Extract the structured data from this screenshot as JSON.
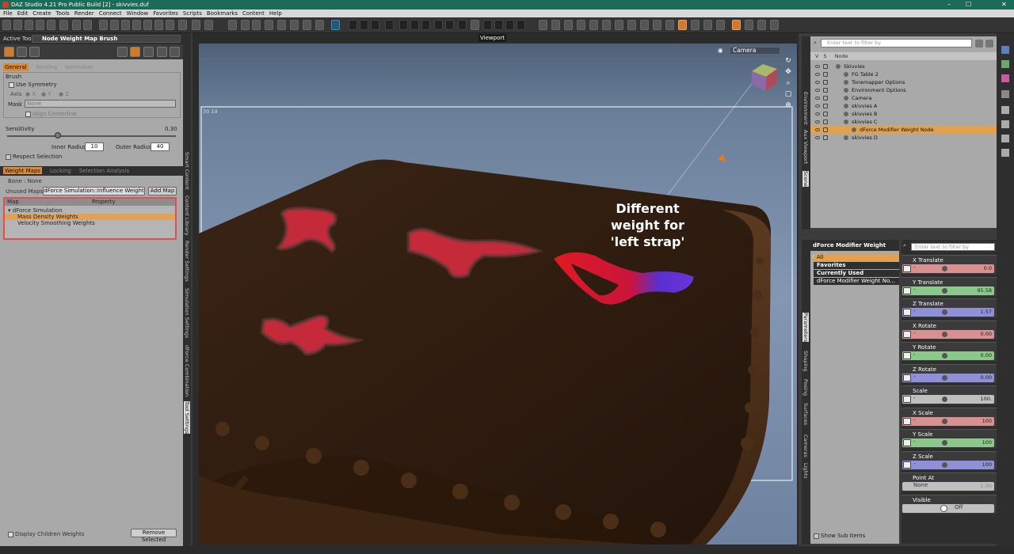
{
  "window": {
    "title": "DAZ Studio 4.21 Pro Public Build [2] - skivvies.duf",
    "minimize": "–",
    "maximize": "☐",
    "close": "✕"
  },
  "menu": [
    "File",
    "Edit",
    "Create",
    "Tools",
    "Render",
    "Connect",
    "Window",
    "Favorites",
    "Scripts",
    "Bookmarks",
    "Content",
    "Help"
  ],
  "left_panel": {
    "active_tool_label": "Active Tool",
    "active_tool_value": "Node Weight Map Brush",
    "tabs": [
      "General",
      "Binding",
      "Normalize"
    ],
    "brush_heading": "Brush",
    "use_symmetry_label": "Use Symmetry",
    "axis_label": "Axis",
    "axis_options": [
      "X",
      "Y",
      "Z"
    ],
    "mask_label": "Mask",
    "mask_value": "None",
    "align_centerline_label": "Align Centerline",
    "sensitivity_label": "Sensitivity",
    "sensitivity_value": "0.30",
    "sensitivity_level": 0.3,
    "inner_radius_label": "Inner Radius",
    "inner_radius_value": "10",
    "outer_radius_label": "Outer Radius",
    "outer_radius_value": "40",
    "respect_selection_label": "Respect Selection",
    "weight_tabs": [
      "Weight Maps",
      "Locking",
      "Selection Analysis"
    ],
    "bone_text": "Bone : None",
    "unused_maps_label": "Unused Maps",
    "unused_maps_value": "dForce Simulation::Influence Weight",
    "add_map_label": "Add Map",
    "map_col": "Map",
    "property_col": "Property",
    "map_group": "dForce Simulation",
    "map_items": [
      "Mass Density Weights",
      "Velocity Smoothing Weights"
    ],
    "display_children_label": "Display Children Weights",
    "remove_selected_label": "Remove Selected"
  },
  "left_side_tabs": [
    "Smart Content",
    "Content Library",
    "Render Settings",
    "Simulation Settings",
    "dForce Combination",
    "Tool Settings"
  ],
  "viewport": {
    "title": "Viewport",
    "camera_label": "Camera",
    "frame_label": "30   19",
    "annotation": [
      "Different",
      "weight for",
      "'left strap'"
    ]
  },
  "scene": {
    "filter_placeholder": "Enter text to filter by",
    "col_v": "V",
    "col_s": "S",
    "col_node": "Node",
    "nodes": [
      {
        "name": "Skivvies"
      },
      {
        "name": "FG Table 2"
      },
      {
        "name": "Tonemapper Options"
      },
      {
        "name": "Environment Options"
      },
      {
        "name": "Camera"
      },
      {
        "name": "skivvies A"
      },
      {
        "name": "skivvies B"
      },
      {
        "name": "skivvies C"
      },
      {
        "name": "dForce Modifier Weight Node"
      },
      {
        "name": "skivvies D"
      }
    ]
  },
  "right_top_tabs": [
    "Environment",
    "Aux Viewport",
    "Scene"
  ],
  "right_bottom_tabs": [
    "Parameters",
    "Shaping",
    "Posing",
    "Surfaces",
    "Cameras",
    "Lights"
  ],
  "params": {
    "node_select": "dForce Modifier Weight Node",
    "list": [
      "All",
      "Favorites",
      "Currently Used",
      "dForce Modifier Weight No..."
    ],
    "filter_placeholder": "Enter text to filter by",
    "items": [
      {
        "label": "X Translate",
        "value": "0.0",
        "color": "#d89090"
      },
      {
        "label": "Y Translate",
        "value": "95.58",
        "color": "#8cc88c"
      },
      {
        "label": "Z Translate",
        "value": "1.57",
        "color": "#9090d8"
      },
      {
        "label": "X Rotate",
        "value": "0.00",
        "color": "#d89090"
      },
      {
        "label": "Y Rotate",
        "value": "0.00",
        "color": "#8cc88c"
      },
      {
        "label": "Z Rotate",
        "value": "0.00",
        "color": "#9090d8"
      },
      {
        "label": "Scale",
        "value": "100.",
        "color": "#bfbfbf"
      },
      {
        "label": "X Scale",
        "value": "100",
        "color": "#d89090"
      },
      {
        "label": "Y Scale",
        "value": "100",
        "color": "#8cc88c"
      },
      {
        "label": "Z Scale",
        "value": "100",
        "color": "#9090d8"
      }
    ],
    "point_at_label": "Point At",
    "point_at_value": "None",
    "point_at_num": "1.00",
    "visible_label": "Visible",
    "visible_value": "Off",
    "show_sub_items_label": "Show Sub Items"
  }
}
